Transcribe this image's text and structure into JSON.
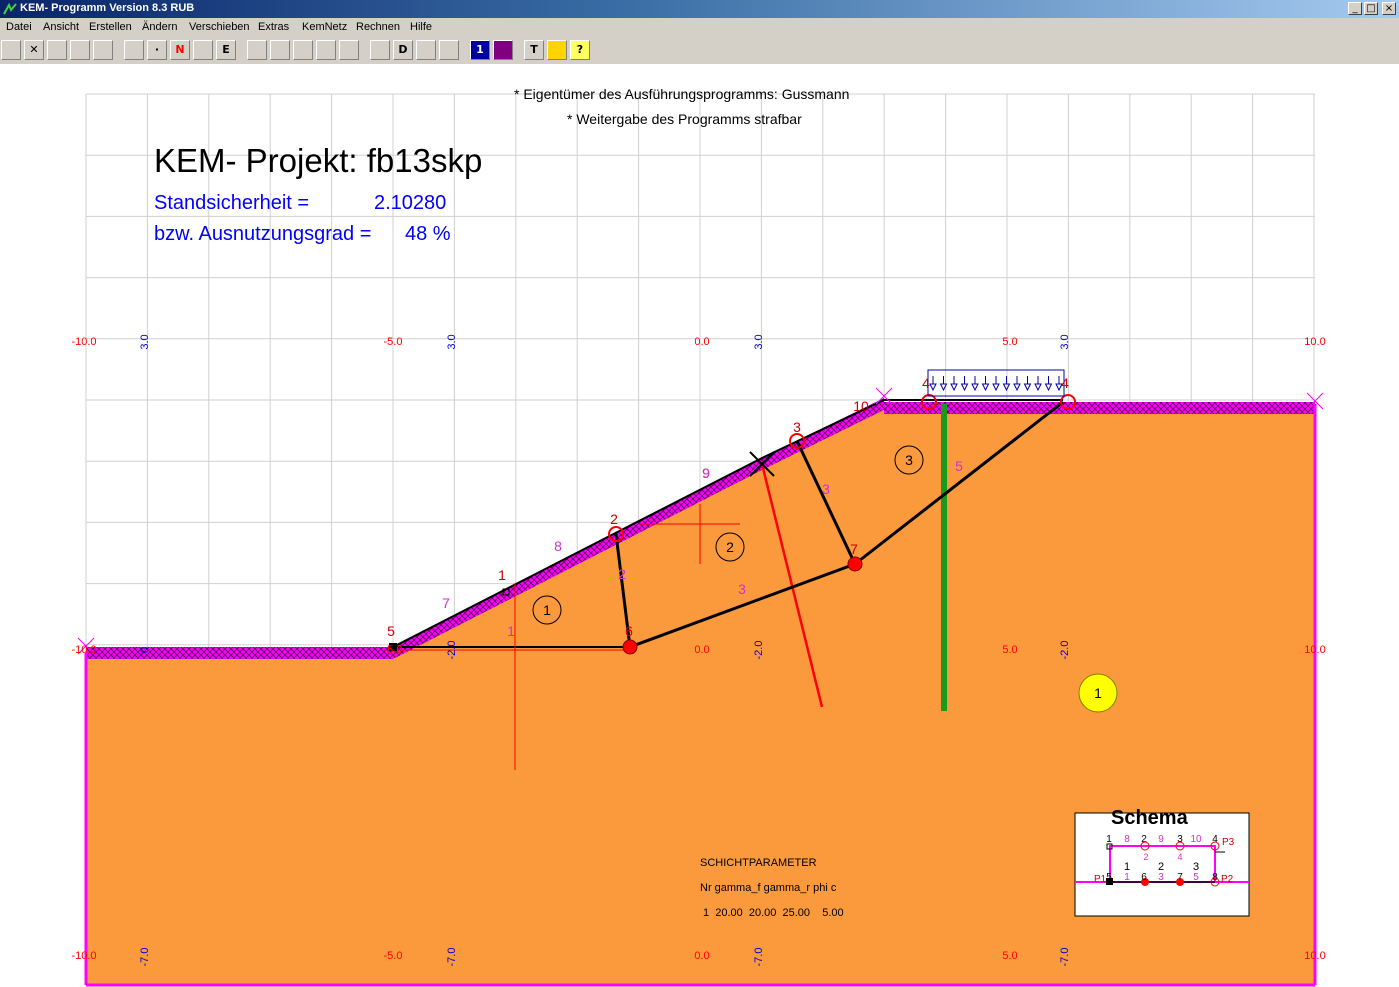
{
  "window": {
    "title": "KEM- Programm Version 8.3 RUB",
    "buttons": [
      "_",
      "□",
      "×"
    ]
  },
  "menu": [
    "Datei",
    "Ansicht",
    "Erstellen",
    "Ändern",
    "Verschieben",
    "Extras",
    "KemNetz",
    "Rechnen",
    "Hilfe"
  ],
  "toolbar": [
    {
      "name": "open-icon",
      "glyph": ""
    },
    {
      "name": "close-icon",
      "glyph": "✕"
    },
    {
      "name": "save-icon",
      "glyph": ""
    },
    {
      "name": "print-icon",
      "glyph": ""
    },
    {
      "name": "print-preview-icon",
      "glyph": ""
    },
    {
      "name": "grid-icon",
      "glyph": ""
    },
    {
      "name": "point-icon",
      "glyph": "·"
    },
    {
      "name": "no-symbol-icon",
      "glyph": "N"
    },
    {
      "name": "color-icon",
      "glyph": ""
    },
    {
      "name": "edit-e-icon",
      "glyph": "E"
    },
    {
      "name": "move-icon",
      "glyph": ""
    },
    {
      "name": "zoom-icon",
      "glyph": ""
    },
    {
      "name": "pan-icon",
      "glyph": ""
    },
    {
      "name": "triangle-icon",
      "glyph": ""
    },
    {
      "name": "polygon-icon",
      "glyph": ""
    },
    {
      "name": "arrow-down-icon",
      "glyph": ""
    },
    {
      "name": "d-arrow-icon",
      "glyph": "D"
    },
    {
      "name": "load-arrow-icon",
      "glyph": ""
    },
    {
      "name": "line-arrow-icon",
      "glyph": ""
    },
    {
      "name": "one-icon",
      "glyph": "1"
    },
    {
      "name": "matrix-icon",
      "glyph": ""
    },
    {
      "name": "text-icon",
      "glyph": "T"
    },
    {
      "name": "color-grid-icon",
      "glyph": ""
    },
    {
      "name": "help-icon",
      "glyph": "?"
    }
  ],
  "header": {
    "owner_note": "* Eigentümer des Ausführungsprogramms: Gussmann",
    "copy_note": "* Weitergabe des Programms strafbar",
    "project_title": "KEM- Projekt: fb13skp",
    "safety_label": "Standsicherheit =",
    "safety_value": "2.10280",
    "utilization_label": "bzw. Ausnutzungsgrad =",
    "utilization_value": "48 %"
  },
  "axes": {
    "x_labels": [
      "-10.0",
      "-5.0",
      "0.0",
      "5.0",
      "10.0"
    ],
    "top_row": [
      "3.0",
      "3.0",
      "3.0",
      "3.0"
    ],
    "mid_row": [
      "0",
      "-2.0",
      "-2.0",
      "-2.0"
    ],
    "bottom_row": [
      "-7.0",
      "-7.0",
      "-7.0",
      "-7.0"
    ]
  },
  "model": {
    "point_labels": [
      "1",
      "2",
      "3",
      "4",
      "5",
      "6",
      "7",
      "8",
      "9",
      "10"
    ],
    "element_labels": [
      "1",
      "2",
      "3",
      "4",
      "5",
      "7",
      "8",
      "9",
      "3",
      "1",
      "2",
      "3",
      "4",
      "5"
    ],
    "body_labels": [
      "1",
      "2",
      "3"
    ],
    "layer_label": "1"
  },
  "layer_params": {
    "title": "SCHICHTPARAMETER",
    "header": "Nr gamma_f gamma_r phi c",
    "row": "1  20.00  20.00  25.00    5.00"
  },
  "schema": {
    "title": "Schema",
    "top_numbers": [
      "1",
      "8",
      "2",
      "9",
      "3",
      "10",
      "4"
    ],
    "mid_numbers": [
      "1",
      "2",
      "3"
    ],
    "low_numbers": [
      "5",
      "1",
      "6",
      "3",
      "7",
      "5",
      "8"
    ],
    "sub_numbers": [
      "2",
      "4"
    ],
    "point_tags": [
      "P1",
      "P2",
      "P3"
    ]
  },
  "colors": {
    "soil": "#fb9a3c",
    "surface": "#ff00ff",
    "grid": "#d0d0d0",
    "axis_red": "#ff0000",
    "axis_blue": "#0000cc",
    "wall": "#1a9a1a",
    "text_blue": "#0000ff",
    "titlebar": "#0a246a"
  }
}
